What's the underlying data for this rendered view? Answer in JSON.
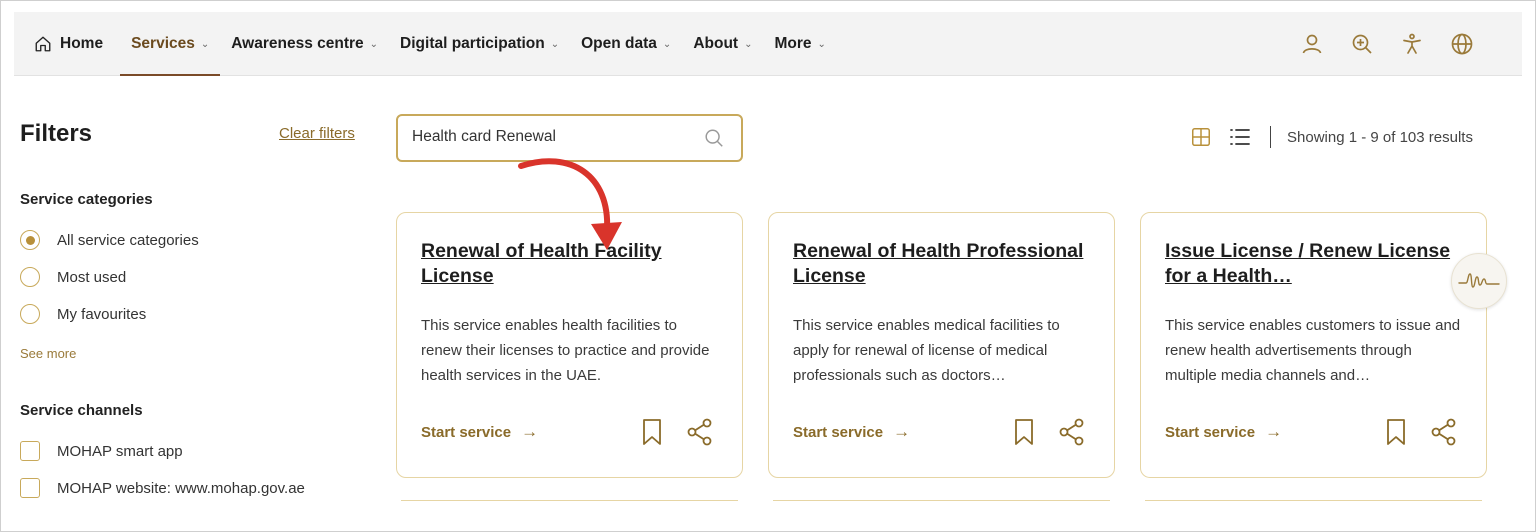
{
  "nav": {
    "items": [
      {
        "label": "Home"
      },
      {
        "label": "Services"
      },
      {
        "label": "Awareness centre"
      },
      {
        "label": "Digital participation"
      },
      {
        "label": "Open data"
      },
      {
        "label": "About"
      },
      {
        "label": "More"
      }
    ],
    "active": "Services",
    "right_icons": [
      "user-icon",
      "zoom-in-icon",
      "accessibility-icon",
      "globe-icon"
    ]
  },
  "filters": {
    "title": "Filters",
    "clear_label": "Clear filters",
    "categories": {
      "heading": "Service categories",
      "options": [
        {
          "label": "All service categories",
          "selected": true
        },
        {
          "label": "Most used",
          "selected": false
        },
        {
          "label": "My favourites",
          "selected": false
        }
      ],
      "see_more": "See more"
    },
    "channels": {
      "heading": "Service channels",
      "options": [
        {
          "label": "MOHAP smart app",
          "checked": false
        },
        {
          "label": "MOHAP website: www.mohap.gov.ae",
          "checked": false
        }
      ]
    }
  },
  "search": {
    "value": "Health card Renewal"
  },
  "results": {
    "text": "Showing 1 - 9 of 103 results"
  },
  "cards": [
    {
      "title": "Renewal of Health Facility License",
      "description": "This service enables health facilities to renew their licenses to practice and provide health services in the UAE.",
      "cta": "Start service"
    },
    {
      "title": "Renewal of Health Professional License",
      "description": "This service enables medical facilities to apply for renewal of license of medical professionals such as doctors…",
      "cta": "Start service"
    },
    {
      "title": "Issue License / Renew License for a Health…",
      "description": "This service enables customers to issue and renew health advertisements through multiple media channels and…",
      "cta": "Start service"
    }
  ],
  "colors": {
    "accent": "#c8a95b",
    "brand_text": "#8a6b2a",
    "annotation_arrow": "#d9342b"
  }
}
